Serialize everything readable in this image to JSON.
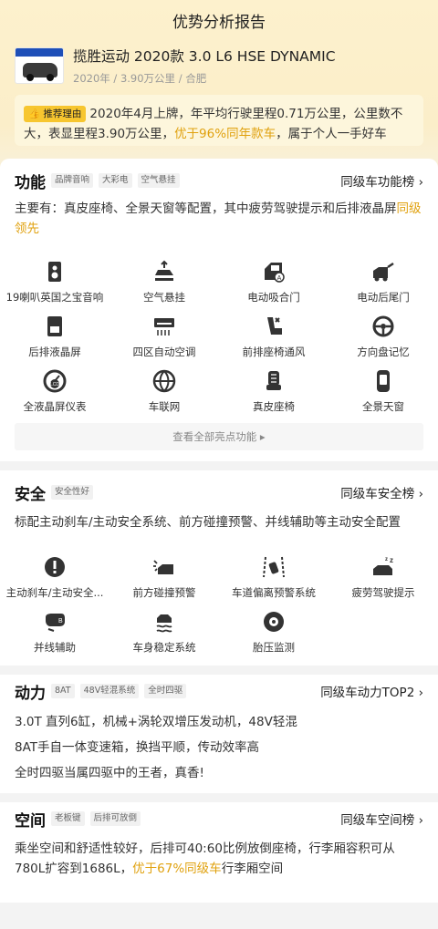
{
  "page": {
    "title": "优势分析报告"
  },
  "car": {
    "thumb_text": "腾讯新能二手车广场",
    "name": "揽胜运动 2020款 3.0 L6 HSE DYNAMIC",
    "meta": "2020年 / 3.90万公里 / 合肥"
  },
  "recommend": {
    "tag": "推荐理由",
    "text_a": "2020年4月上牌，年平均行驶里程0.71万公里，公里数不大，表显里程3.90万公里，",
    "highlight": "优于96%同年款车",
    "text_b": "，属于个人一手好车"
  },
  "function": {
    "title": "功能",
    "tags": [
      "品牌音响",
      "大彩电",
      "空气悬挂"
    ],
    "link": "同级车功能榜",
    "desc_a": "主要有：真皮座椅、全景天窗等配置，其中疲劳驾驶提示和后排液晶屏",
    "desc_hl": "同级领先",
    "items": [
      {
        "label": "19喇叭英国之宝音响",
        "icon": "speaker-icon"
      },
      {
        "label": "空气悬挂",
        "icon": "air-suspension-icon"
      },
      {
        "label": "电动吸合门",
        "icon": "soft-close-door-icon"
      },
      {
        "label": "电动后尾门",
        "icon": "power-tailgate-icon"
      },
      {
        "label": "后排液晶屏",
        "icon": "rear-screen-icon"
      },
      {
        "label": "四区自动空调",
        "icon": "climate-icon"
      },
      {
        "label": "前排座椅通风",
        "icon": "seat-ventilation-icon"
      },
      {
        "label": "方向盘记忆",
        "icon": "steering-memory-icon"
      },
      {
        "label": "全液晶屏仪表",
        "icon": "lcd-cluster-icon"
      },
      {
        "label": "车联网",
        "icon": "connected-car-icon"
      },
      {
        "label": "真皮座椅",
        "icon": "leather-seat-icon"
      },
      {
        "label": "全景天窗",
        "icon": "panoramic-roof-icon"
      }
    ],
    "more": "查看全部亮点功能"
  },
  "safety": {
    "title": "安全",
    "tags": [
      "安全性好"
    ],
    "link": "同级车安全榜",
    "desc": "标配主动刹车/主动安全系统、前方碰撞预警、并线辅助等主动安全配置",
    "items": [
      {
        "label": "主动刹车/主动安全...",
        "icon": "active-brake-icon"
      },
      {
        "label": "前方碰撞预警",
        "icon": "collision-warning-icon"
      },
      {
        "label": "车道偏离预警系统",
        "icon": "lane-departure-icon"
      },
      {
        "label": "疲劳驾驶提示",
        "icon": "fatigue-alert-icon"
      },
      {
        "label": "并线辅助",
        "icon": "blind-spot-icon"
      },
      {
        "label": "车身稳定系统",
        "icon": "stability-icon"
      },
      {
        "label": "胎压监测",
        "icon": "tire-pressure-icon"
      }
    ]
  },
  "power": {
    "title": "动力",
    "tags": [
      "8AT",
      "48V轻混系统",
      "全时四驱"
    ],
    "link": "同级车动力TOP2",
    "lines": [
      "3.0T 直列6缸，机械+涡轮双增压发动机，48V轻混",
      "8AT手自一体变速箱，换挡平顺，传动效率高",
      "全时四驱当属四驱中的王者，真香!"
    ]
  },
  "space": {
    "title": "空间",
    "tags": [
      "老板键",
      "后排可放倒"
    ],
    "link": "同级车空间榜",
    "desc_a": "乘坐空间和舒适性较好，后排可40:60比例放倒座椅，行李厢容积可从780L扩容到1686L，",
    "desc_hl": "优于67%同级车",
    "desc_b": "行李厢空间"
  },
  "colors": {
    "accent": "#e0a10e",
    "tag_yellow": "#f7c62f"
  }
}
